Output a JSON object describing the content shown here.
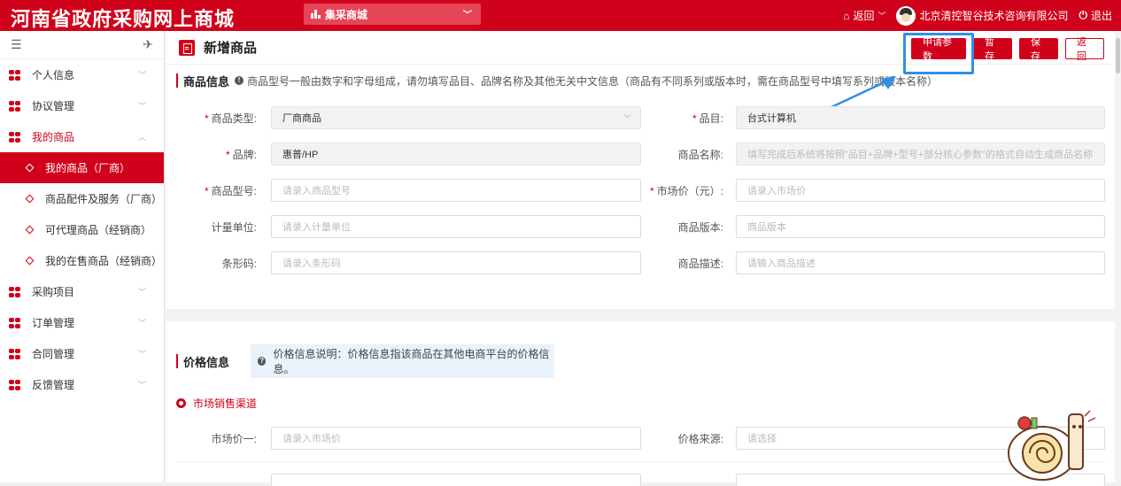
{
  "header": {
    "brand": "河南省政府采购网上商城",
    "mall_select": "集采商城",
    "back_label": "返回",
    "company": "北京清控智谷技术咨询有限公司",
    "logout": "退出"
  },
  "sidebar": {
    "items": [
      {
        "label": "个人信息"
      },
      {
        "label": "协议管理"
      },
      {
        "label": "我的商品"
      },
      {
        "label": "采购项目"
      },
      {
        "label": "订单管理"
      },
      {
        "label": "合同管理"
      },
      {
        "label": "反馈管理"
      }
    ],
    "subitems": [
      {
        "label": "我的商品（厂商）"
      },
      {
        "label": "商品配件及服务（厂商）"
      },
      {
        "label": "可代理商品（经销商）"
      },
      {
        "label": "我的在售商品（经销商）"
      }
    ]
  },
  "page": {
    "title": "新增商品",
    "buttons": {
      "apply_params": "申请参数",
      "draft": "暂存",
      "save": "保存",
      "back": "返回"
    }
  },
  "product_info": {
    "title": "商品信息",
    "note": "商品型号一般由数字和字母组成，请勿填写品目、品牌名称及其他无关中文信息（商品有不同系列或版本时，需在商品型号中填写系列或版本名称）",
    "fields": {
      "type_label": "商品类型:",
      "type_value": "厂商商品",
      "category_label": "品目:",
      "category_value": "台式计算机",
      "brand_label": "品牌:",
      "brand_value": "惠普/HP",
      "name_label": "商品名称:",
      "name_placeholder": "填写完成后系统将按照\"品目+品牌+型号+部分核心参数\"的格式自动生成商品名称",
      "model_label": "商品型号:",
      "model_placeholder": "请录入商品型号",
      "market_price_label": "市场价（元）:",
      "market_price_placeholder": "请录入市场价",
      "unit_label": "计量单位:",
      "unit_placeholder": "请录入计量单位",
      "version_label": "商品版本:",
      "version_placeholder": "商品版本",
      "barcode_label": "条形码:",
      "barcode_placeholder": "请录入条形码",
      "desc_label": "商品描述:",
      "desc_placeholder": "请输入商品描述"
    }
  },
  "price_info": {
    "title": "价格信息",
    "note": "价格信息说明：价格信息指该商品在其他电商平台的价格信息。",
    "channel": "市场销售渠道",
    "market_price_1_label": "市场价一:",
    "market_price_1_placeholder": "请录入市场价",
    "source_label": "价格来源:",
    "source_placeholder": "请选择"
  },
  "colors": {
    "brand_red": "#d0021b",
    "highlight_blue": "#2f8fe8"
  }
}
